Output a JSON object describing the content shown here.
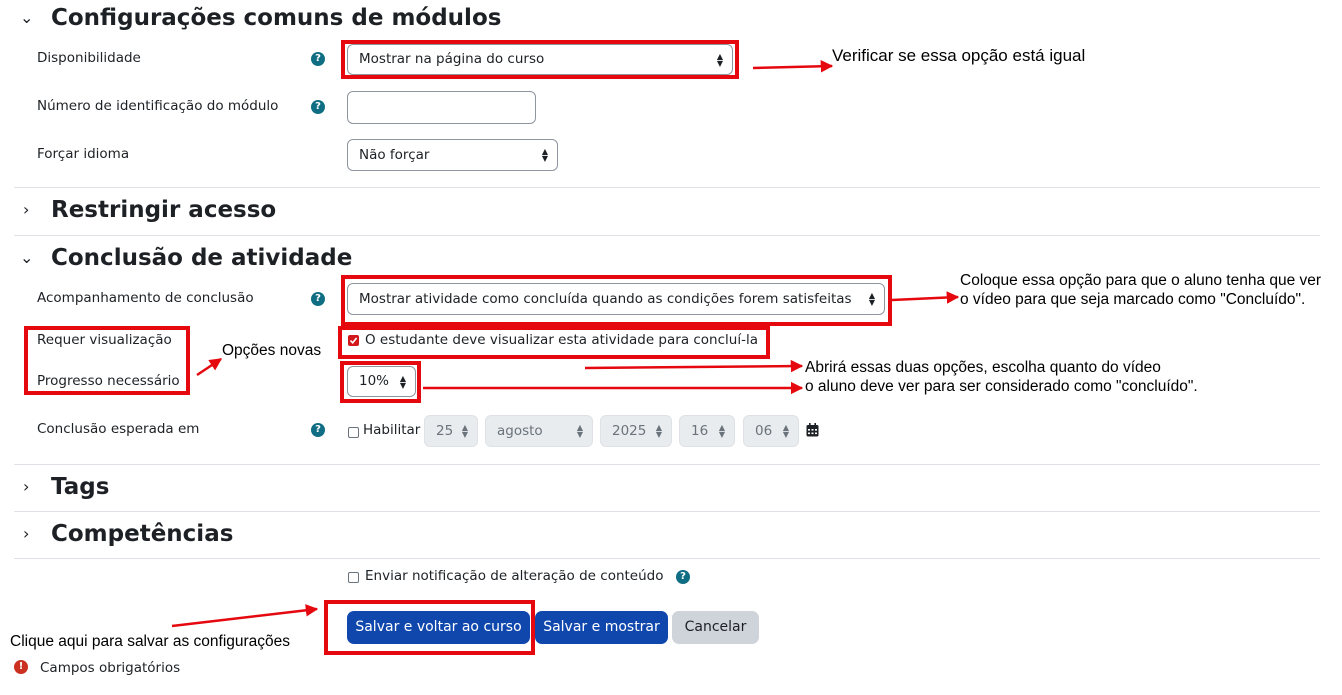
{
  "sections": {
    "common": "Configurações comuns de módulos",
    "restrict": "Restringir acesso",
    "completion": "Conclusão de atividade",
    "tags": "Tags",
    "competencies": "Competências"
  },
  "fields": {
    "availability": {
      "label": "Disponibilidade",
      "value": "Mostrar na página do curso"
    },
    "idnumber": {
      "label": "Número de identificação do módulo",
      "value": ""
    },
    "lang": {
      "label": "Forçar idioma",
      "value": "Não forçar"
    },
    "tracking": {
      "label": "Acompanhamento de conclusão",
      "value": "Mostrar atividade como concluída quando as condições forem satisfeitas"
    },
    "view": {
      "label": "Requer visualização",
      "checkbox": "O estudante deve visualizar esta atividade para concluí-la",
      "checked": true
    },
    "progress": {
      "label": "Progresso necessário",
      "value": "10%"
    },
    "expected": {
      "label": "Conclusão esperada em",
      "enable": "Habilitar",
      "day": "25",
      "month": "agosto",
      "year": "2025",
      "hour": "16",
      "minute": "06"
    },
    "notify": {
      "label": "Enviar notificação de alteração de conteúdo"
    }
  },
  "buttons": {
    "save_return": "Salvar e voltar ao curso",
    "save_display": "Salvar e mostrar",
    "cancel": "Cancelar"
  },
  "required_note": "Campos obrigatórios",
  "annotations": {
    "a1": "Verificar se essa opção está igual",
    "a2_line1": "Coloque essa opção para que o aluno tenha que ver",
    "a2_line2": "o vídeo para que seja marcado como \"Concluído\".",
    "a3": "Opções novas",
    "a4_line1": "Abrirá essas duas opções, escolha quanto do vídeo",
    "a4_line2": "o aluno deve ver para ser considerado como \"concluído\".",
    "a5": "Clique aqui para salvar as configurações"
  },
  "icons": {
    "help": "question-circle-icon",
    "calendar": "calendar-icon",
    "required": "exclamation-circle-icon"
  },
  "colors": {
    "accent": "#0f6e83",
    "primary": "#0f47ad",
    "annotation_red": "#e5080f"
  }
}
